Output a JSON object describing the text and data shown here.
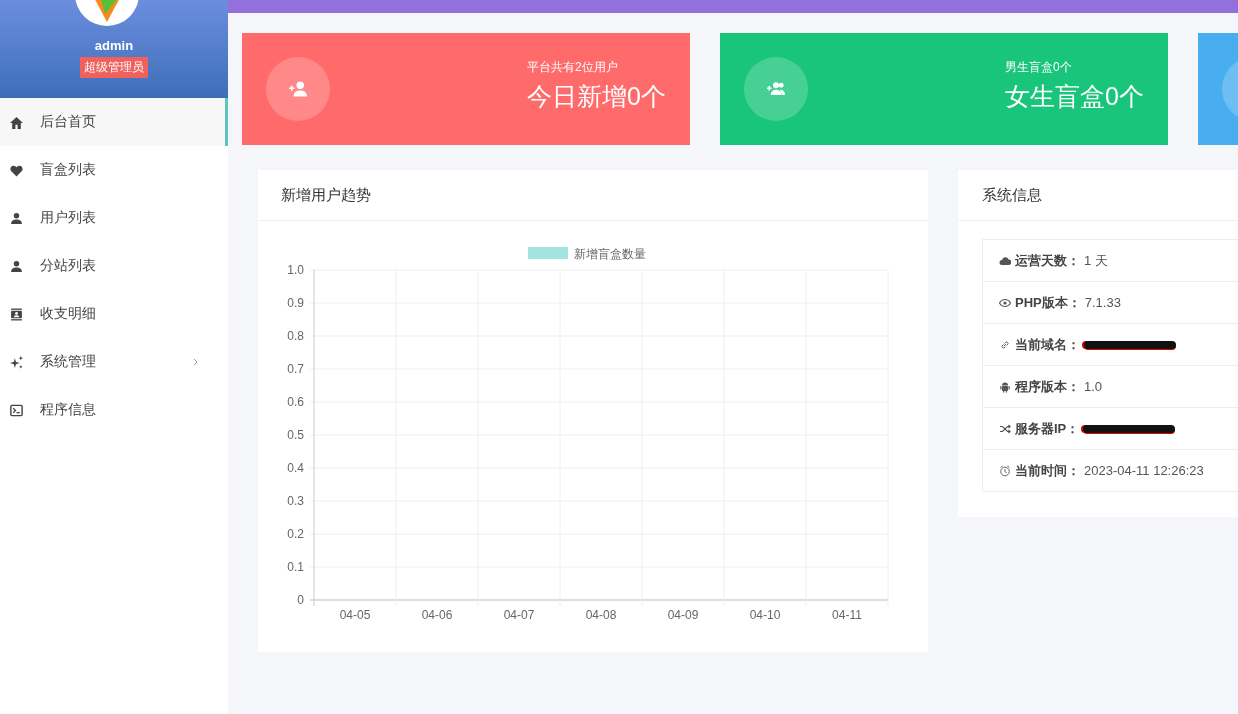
{
  "sidebar": {
    "user": {
      "name": "admin",
      "role": "超级管理员"
    },
    "items": [
      {
        "label": "后台首页",
        "kind": "home",
        "selected": true,
        "expandable": false
      },
      {
        "label": "盲盒列表",
        "kind": "heart",
        "selected": false,
        "expandable": false
      },
      {
        "label": "用户列表",
        "kind": "person",
        "selected": false,
        "expandable": false
      },
      {
        "label": "分站列表",
        "kind": "person",
        "selected": false,
        "expandable": false
      },
      {
        "label": "收支明细",
        "kind": "contact",
        "selected": false,
        "expandable": false
      },
      {
        "label": "系统管理",
        "kind": "sparkle",
        "selected": false,
        "expandable": true
      },
      {
        "label": "程序信息",
        "kind": "terminal",
        "selected": false,
        "expandable": false
      }
    ]
  },
  "stat_cards": [
    {
      "caption": "平台共有2位用户",
      "value": "今日新增0个",
      "color": "#ff6b6b",
      "kind": "userplus"
    },
    {
      "caption": "男生盲盒0个",
      "value": "女生盲盒0个",
      "color": "#19c57a",
      "kind": "groupplus"
    },
    {
      "color": "#49aef0"
    }
  ],
  "chart_panel": {
    "title": "新增用户趋势",
    "chart_data": {
      "type": "bar",
      "grid": true,
      "categories": [
        "04-05",
        "04-06",
        "04-07",
        "04-08",
        "04-09",
        "04-10",
        "04-11"
      ],
      "series": [
        {
          "name": "新增盲盒数量",
          "color": "#a3e4e1",
          "values": [
            0,
            0,
            0,
            0,
            0,
            0,
            0
          ]
        }
      ],
      "ylim": [
        0,
        1
      ],
      "yticks": [
        0,
        0.1,
        0.2,
        0.3,
        0.4,
        0.5,
        0.6,
        0.7,
        0.8,
        0.9,
        {
          "value": 1,
          "label": "1.0"
        }
      ]
    }
  },
  "system_info": {
    "title": "系统信息",
    "rows": [
      {
        "kind": "cloud",
        "label": "运营天数：",
        "value": "1 天",
        "redacted": false
      },
      {
        "kind": "eye",
        "label": "PHP版本：",
        "value": "7.1.33",
        "redacted": false
      },
      {
        "kind": "link",
        "label": "当前域名：",
        "redacted": true
      },
      {
        "kind": "android",
        "label": "程序版本：",
        "value": "1.0",
        "redacted": false
      },
      {
        "kind": "shuffle",
        "label": "服务器IP：",
        "redacted": true
      },
      {
        "kind": "clock",
        "label": "当前时间：",
        "value": "2023-04-11 12:26:23",
        "redacted": false
      }
    ]
  }
}
